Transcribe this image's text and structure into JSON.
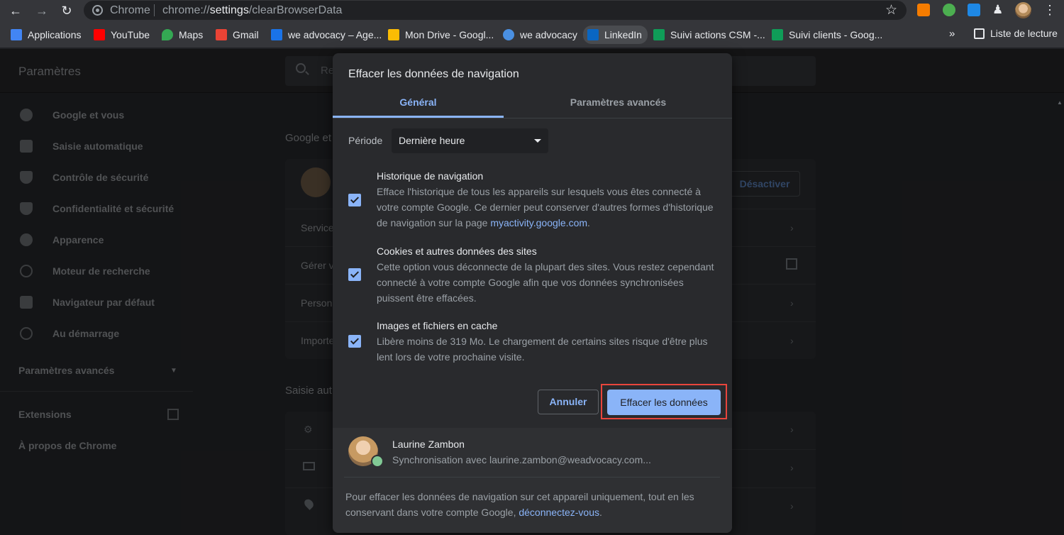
{
  "browser": {
    "site_label": "Chrome",
    "url_prefix": "chrome://",
    "url_host": "settings",
    "url_path": "/clearBrowserData"
  },
  "bookmarks": {
    "items": [
      {
        "label": "Applications",
        "color": "#4285f4"
      },
      {
        "label": "YouTube",
        "color": "#ff0000"
      },
      {
        "label": "Maps",
        "color": "#34a853"
      },
      {
        "label": "Gmail",
        "color": "#ea4335"
      },
      {
        "label": "we advocacy – Age...",
        "color": "#1a73e8"
      },
      {
        "label": "Mon Drive - Googl...",
        "color": "#fbbc04"
      },
      {
        "label": "we advocacy",
        "color": "#4a90e2"
      },
      {
        "label": "LinkedIn",
        "color": "#0a66c2"
      },
      {
        "label": "Suivi actions CSM -...",
        "color": "#0f9d58"
      },
      {
        "label": "Suivi clients - Goog...",
        "color": "#0f9d58"
      }
    ],
    "more": "»",
    "reading_list": "Liste de lecture"
  },
  "settings": {
    "title": "Paramètres",
    "search_placeholder": "Re",
    "sidebar": [
      {
        "label": "Google et vous"
      },
      {
        "label": "Saisie automatique"
      },
      {
        "label": "Contrôle de sécurité"
      },
      {
        "label": "Confidentialité et sécurité"
      },
      {
        "label": "Apparence"
      },
      {
        "label": "Moteur de recherche"
      },
      {
        "label": "Navigateur par défaut"
      },
      {
        "label": "Au démarrage"
      }
    ],
    "advanced": "Paramètres avancés",
    "extensions": "Extensions",
    "about": "À propos de Chrome",
    "section_google": "Google et",
    "section_autofill": "Saisie aut",
    "deactivate": "Désactiver",
    "rows": [
      "Service",
      "Gérer v",
      "Person",
      "Importe"
    ]
  },
  "dialog": {
    "title": "Effacer les données de navigation",
    "tabs": {
      "general": "Général",
      "advanced": "Paramètres avancés"
    },
    "period_label": "Période",
    "period_value": "Dernière heure",
    "options": [
      {
        "title": "Historique de navigation",
        "desc": "Efface l'historique de tous les appareils sur lesquels vous êtes connecté à votre compte Google. Ce dernier peut conserver d'autres formes d'historique de navigation sur la page ",
        "link": "myactivity.google.com",
        "desc_end": ".",
        "checked": true
      },
      {
        "title": "Cookies et autres données des sites",
        "desc": "Cette option vous déconnecte de la plupart des sites. Vous restez cependant connecté à votre compte Google afin que vos données synchronisées puissent être effacées.",
        "checked": true
      },
      {
        "title": "Images et fichiers en cache",
        "desc": "Libère moins de 319 Mo. Le chargement de certains sites risque d'être plus lent lors de votre prochaine visite.",
        "checked": true
      }
    ],
    "cancel": "Annuler",
    "confirm": "Effacer les données",
    "sync": {
      "name": "Laurine Zambon",
      "email": "Synchronisation avec laurine.zambon@weadvocacy.com...",
      "note": "Pour effacer les données de navigation sur cet appareil uniquement, tout en les conservant dans votre compte Google, ",
      "note_link": "déconnectez-vous",
      "note_end": "."
    }
  }
}
